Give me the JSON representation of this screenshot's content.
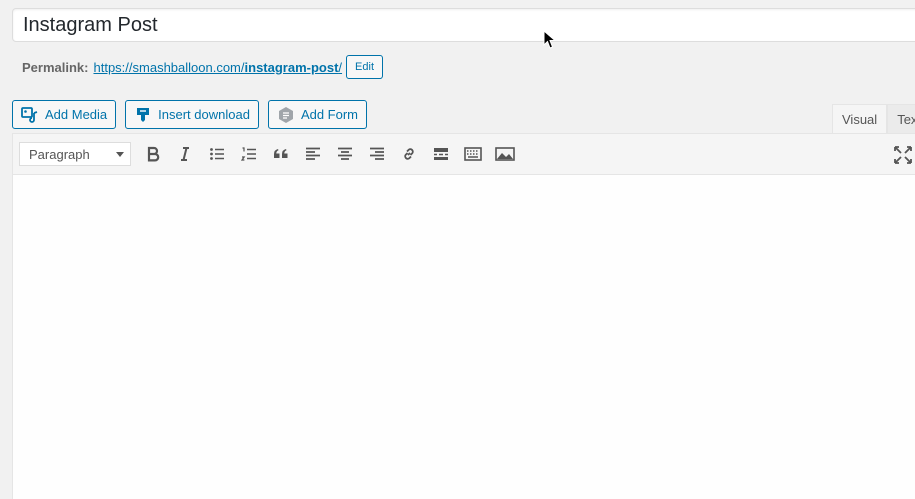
{
  "title": {
    "value": "Instagram Post"
  },
  "permalink": {
    "label": "Permalink:",
    "base": "https://smashballoon.com/",
    "slug": "instagram-post",
    "trail": "/",
    "edit_label": "Edit"
  },
  "media_buttons": {
    "add_media": "Add Media",
    "insert_download": "Insert download",
    "add_form": "Add Form"
  },
  "tabs": {
    "visual": "Visual",
    "text": "Text"
  },
  "toolbar": {
    "format": "Paragraph"
  },
  "colors": {
    "accent": "#0073aa",
    "toolbar_bg": "#f5f5f5",
    "page_bg": "#f1f1f1"
  }
}
